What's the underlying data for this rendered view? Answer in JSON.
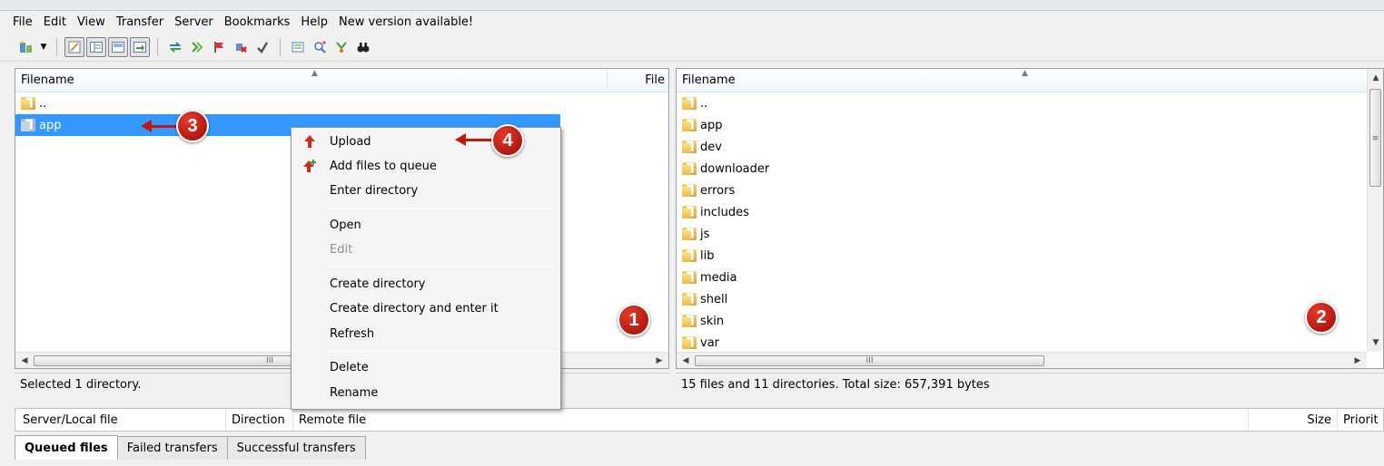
{
  "menubar": {
    "items": [
      "File",
      "Edit",
      "View",
      "Transfer",
      "Server",
      "Bookmarks",
      "Help",
      "New version available!"
    ]
  },
  "toolbar": {
    "icons": [
      "site-manager-icon",
      "dropdown-arrow-icon",
      "toggle-message-log-icon",
      "toggle-local-tree-icon",
      "toggle-remote-tree-icon",
      "toggle-queue-icon",
      "refresh-icon",
      "process-queue-icon",
      "cancel-operation-icon",
      "disconnect-icon",
      "reconnect-icon",
      "directory-listing-filters-icon",
      "compare-icon",
      "synchronized-browsing-icon",
      "search-icon"
    ]
  },
  "local": {
    "columns": [
      "Filename",
      "File"
    ],
    "rows": [
      {
        "name": ".."
      },
      {
        "name": "app",
        "selected": true
      }
    ],
    "status": "Selected 1 directory."
  },
  "remote": {
    "columns": [
      "Filename"
    ],
    "rows": [
      {
        "name": ".."
      },
      {
        "name": "app"
      },
      {
        "name": "dev"
      },
      {
        "name": "downloader"
      },
      {
        "name": "errors"
      },
      {
        "name": "includes"
      },
      {
        "name": "js"
      },
      {
        "name": "lib"
      },
      {
        "name": "media"
      },
      {
        "name": "shell"
      },
      {
        "name": "skin"
      },
      {
        "name": "var"
      }
    ],
    "status": "15 files and 11 directories. Total size: 657,391 bytes"
  },
  "scroll_thumb_grip": "III",
  "queue": {
    "columns": [
      "Server/Local file",
      "Direction",
      "Remote file",
      "Size",
      "Priorit"
    ]
  },
  "tabs": [
    "Queued files",
    "Failed transfers",
    "Successful transfers"
  ],
  "context_menu": {
    "items": [
      {
        "label": "Upload",
        "icon": "upload-arrow-icon"
      },
      {
        "label": "Add files to queue",
        "icon": "add-to-queue-icon"
      },
      {
        "label": "Enter directory"
      },
      {
        "label": "Open"
      },
      {
        "label": "Edit",
        "disabled": true
      },
      {
        "label": "Create directory"
      },
      {
        "label": "Create directory and enter it"
      },
      {
        "label": "Refresh"
      },
      {
        "label": "Delete"
      },
      {
        "label": "Rename"
      }
    ]
  },
  "annotations": [
    "1",
    "2",
    "3",
    "4"
  ],
  "colors": {
    "selection": "#3399ff",
    "annotation": "#c1180e",
    "folder": "#f0b93c"
  }
}
